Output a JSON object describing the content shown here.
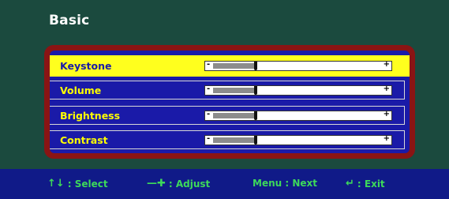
{
  "title": "Basic",
  "menu": {
    "items": [
      {
        "label": "Keystone",
        "level": 0.24,
        "selected": true
      },
      {
        "label": "Volume",
        "level": 0.24,
        "selected": false
      },
      {
        "label": "Brightness",
        "level": 0.24,
        "selected": false
      },
      {
        "label": "Contrast",
        "level": 0.24,
        "selected": false
      }
    ],
    "slider_minus": "-",
    "slider_plus": "+"
  },
  "footer": {
    "select_label": ": Select",
    "adjust_label": ": Adjust",
    "next_label": "Menu : Next",
    "exit_label": ": Exit"
  },
  "colors": {
    "background": "#1b4a3e",
    "frame": "#8a1414",
    "panel": "#1a1aa8",
    "selected_row": "#ffff1e",
    "label_text": "#ffff00",
    "footer_text": "#3dd95a",
    "footer_bg": "#101a88"
  },
  "icons": {
    "select": "up-down-arrows-icon",
    "adjust": "minus-plus-icon",
    "exit": "enter-return-icon"
  }
}
